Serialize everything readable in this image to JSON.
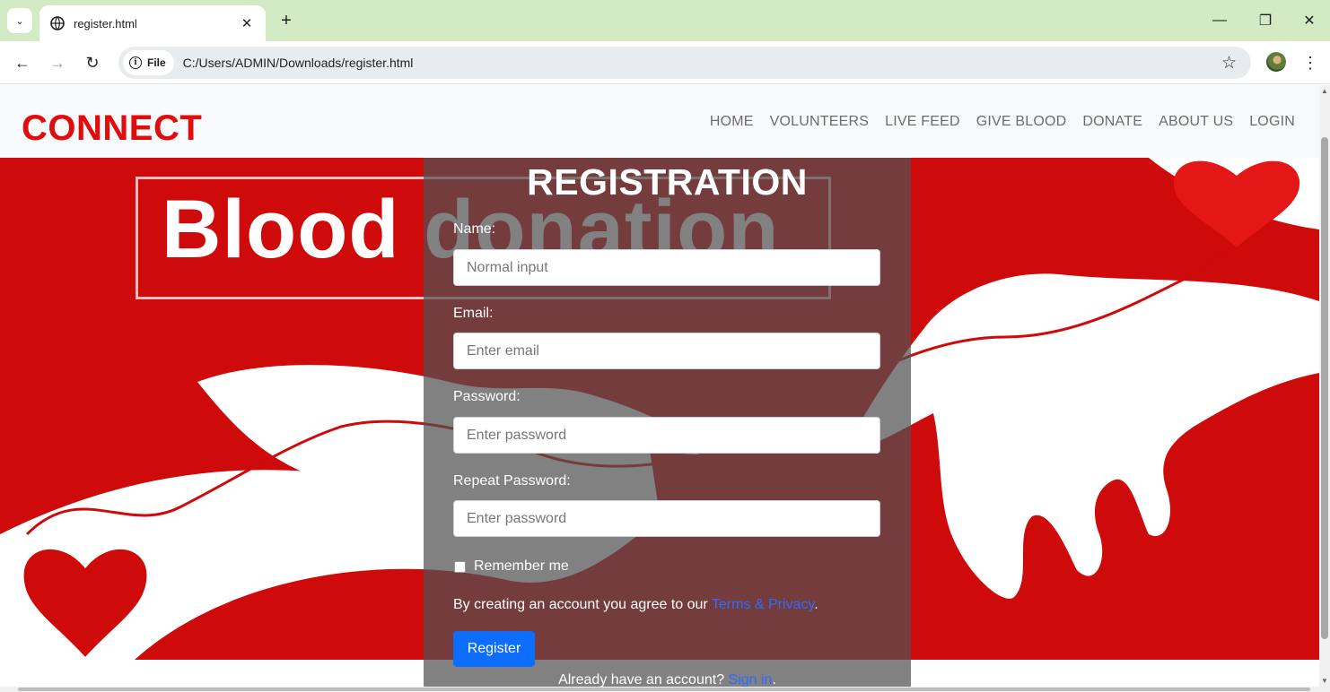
{
  "browser": {
    "tab_title": "register.html",
    "tab_close": "✕",
    "new_tab": "+",
    "tab_search": "⌄",
    "window": {
      "minimize": "—",
      "restore": "❐",
      "close": "✕"
    },
    "nav": {
      "back": "←",
      "forward": "→",
      "reload": "↻"
    },
    "file_chip": "File",
    "url": "C:/Users/ADMIN/Downloads/register.html",
    "bookmark": "☆",
    "menu": "⋮"
  },
  "site": {
    "brand": "CONNECT",
    "brand_color": "#e10d0d",
    "nav": [
      "HOME",
      "VOLUNTEERS",
      "LIVE FEED",
      "GIVE BLOOD",
      "DONATE",
      "ABOUT US",
      "LOGIN"
    ]
  },
  "hero": {
    "title": "Blood donation",
    "bg_color": "#cf0a0a"
  },
  "form": {
    "title": "REGISTRATION",
    "name_label": "Name:",
    "name_placeholder": "Normal input",
    "email_label": "Email:",
    "email_placeholder": "Enter email",
    "password_label": "Password:",
    "password_placeholder": "Enter password",
    "repeat_label": "Repeat Password:",
    "repeat_placeholder": "Enter password",
    "remember": "Remember me",
    "terms_text": "By creating an account you agree to our ",
    "terms_link": "Terms & Privacy",
    "terms_end": ".",
    "register_button": "Register",
    "signin_text": "Already have an account? ",
    "signin_link": "Sign in",
    "signin_end": ".",
    "button_color": "#0d6efd",
    "link_color": "#2f6bff"
  }
}
